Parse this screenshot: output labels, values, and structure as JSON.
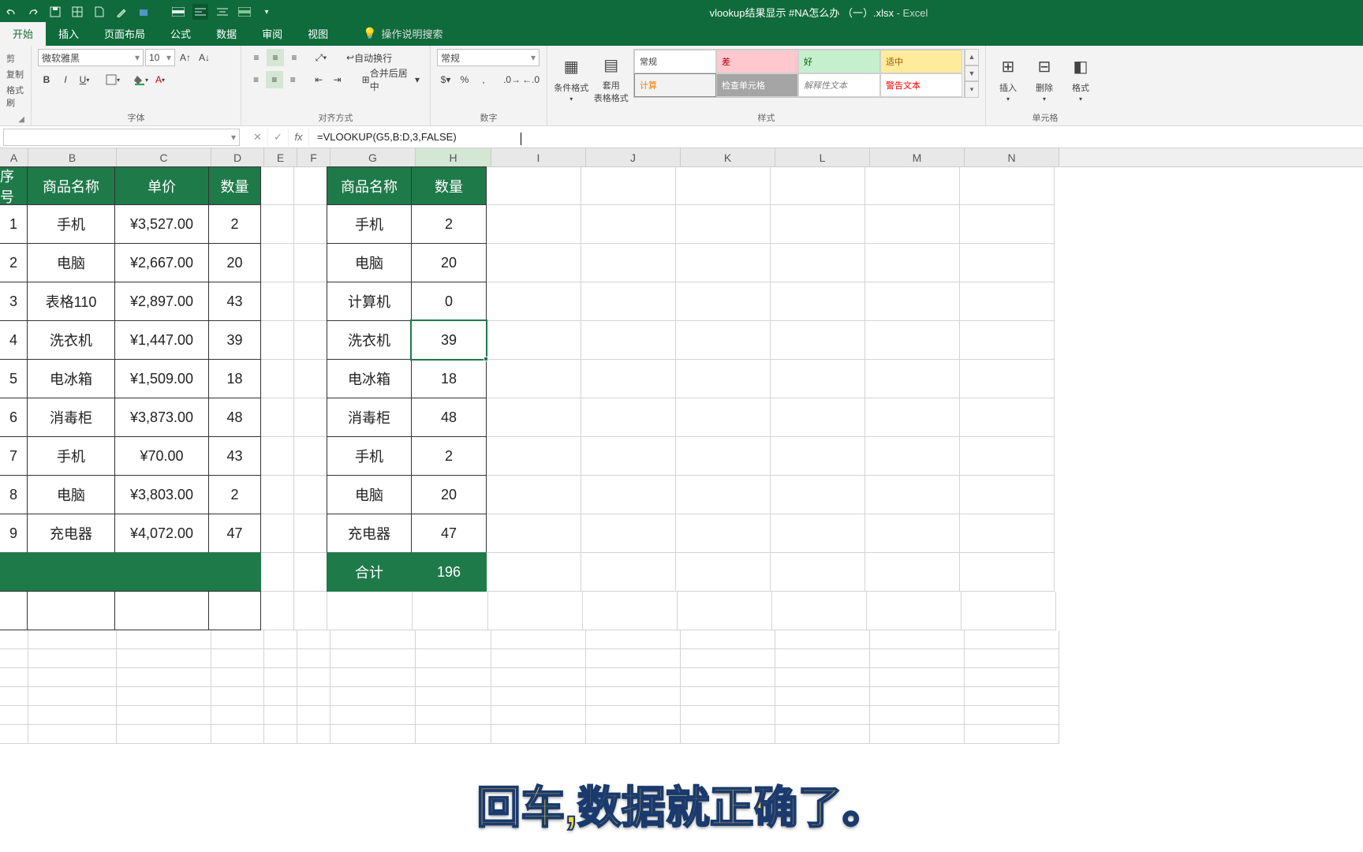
{
  "title": {
    "filename": "vlookup结果显示 #NA怎么办 （一）.xlsx",
    "app": "Excel"
  },
  "tabs": {
    "t0": "开始",
    "t1": "插入",
    "t2": "页面布局",
    "t3": "公式",
    "t4": "数据",
    "t5": "审阅",
    "t6": "视图",
    "tellme": "操作说明搜索"
  },
  "clipboard": {
    "cut": "剪",
    "copy": "复制",
    "paint": "格式刷"
  },
  "font": {
    "name": "微软雅黑",
    "size": "10",
    "label": "字体"
  },
  "align": {
    "wrap": "自动换行",
    "merge": "合并后居中",
    "label": "对齐方式"
  },
  "number": {
    "fmt": "常规",
    "label": "数字"
  },
  "styles": {
    "label": "样式",
    "cond": "条件格式",
    "tbl": "套用\n表格格式",
    "s0": "常规",
    "s1": "差",
    "s2": "好",
    "s3": "适中",
    "s4": "计算",
    "s5": "检查单元格",
    "s6": "解释性文本",
    "s7": "警告文本"
  },
  "cells": {
    "ins": "插入",
    "del": "删除",
    "fmt": "格式",
    "label": "单元格"
  },
  "formulabar": {
    "name": "",
    "formula": "=VLOOKUP(G5,B:D,3,FALSE)"
  },
  "cols": {
    "A": "A",
    "B": "B",
    "C": "C",
    "D": "D",
    "E": "E",
    "F": "F",
    "G": "G",
    "H": "H",
    "I": "I",
    "J": "J",
    "K": "K",
    "L": "L",
    "M": "M",
    "N": "N"
  },
  "t1": {
    "h": {
      "a": "序号",
      "b": "商品名称",
      "c": "单价",
      "d": "数量"
    },
    "r": [
      {
        "a": "1",
        "b": "手机",
        "c": "¥3,527.00",
        "d": "2"
      },
      {
        "a": "2",
        "b": "电脑",
        "c": "¥2,667.00",
        "d": "20"
      },
      {
        "a": "3",
        "b": "表格110",
        "c": "¥2,897.00",
        "d": "43"
      },
      {
        "a": "4",
        "b": "洗衣机",
        "c": "¥1,447.00",
        "d": "39"
      },
      {
        "a": "5",
        "b": "电冰箱",
        "c": "¥1,509.00",
        "d": "18"
      },
      {
        "a": "6",
        "b": "消毒柜",
        "c": "¥3,873.00",
        "d": "48"
      },
      {
        "a": "7",
        "b": "手机",
        "c": "¥70.00",
        "d": "43"
      },
      {
        "a": "8",
        "b": "电脑",
        "c": "¥3,803.00",
        "d": "2"
      },
      {
        "a": "9",
        "b": "充电器",
        "c": "¥4,072.00",
        "d": "47"
      }
    ]
  },
  "t2": {
    "h": {
      "g": "商品名称",
      "h": "数量"
    },
    "r": [
      {
        "g": "手机",
        "h": "2"
      },
      {
        "g": "电脑",
        "h": "20"
      },
      {
        "g": "计算机",
        "h": "0"
      },
      {
        "g": "洗衣机",
        "h": "39"
      },
      {
        "g": "电冰箱",
        "h": "18"
      },
      {
        "g": "消毒柜",
        "h": "48"
      },
      {
        "g": "手机",
        "h": "2"
      },
      {
        "g": "电脑",
        "h": "20"
      },
      {
        "g": "充电器",
        "h": "47"
      }
    ],
    "total": {
      "g": "合计",
      "h": "196"
    }
  },
  "subtitle": "回车,数据就正确了。"
}
